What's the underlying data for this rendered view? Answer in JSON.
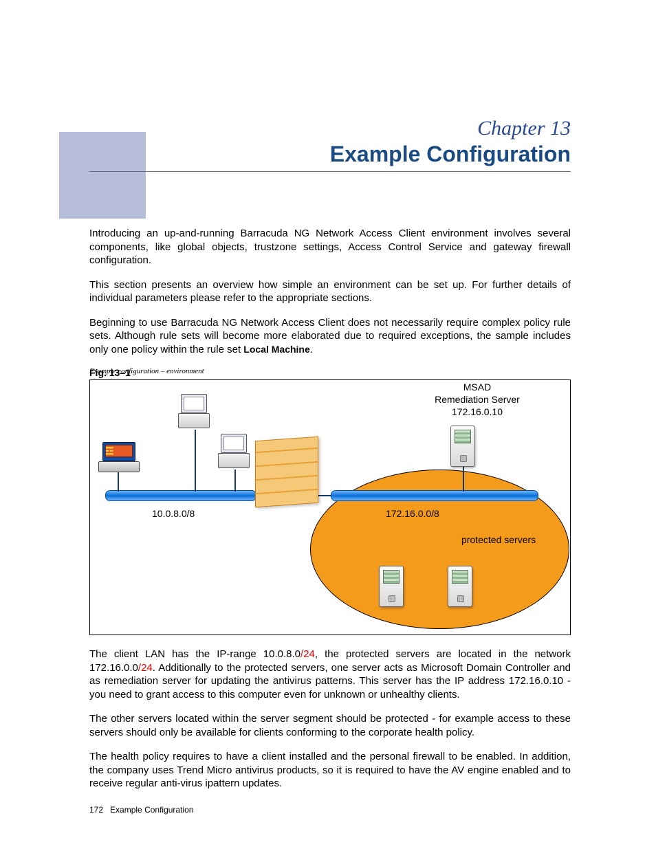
{
  "header": {
    "chapter_line": "Chapter 13",
    "title": "Example Configuration"
  },
  "paragraphs": {
    "p1": "Introducing an up-and-running Barracuda NG Network Access Client environment involves several components, like global objects, trustzone settings, Access Control Service and gateway firewall configuration.",
    "p2": "This section presents an overview how simple an environment can be set up. For further details of individual parameters please refer to the appropriate sections.",
    "p3a": "Beginning to use Barracuda NG Network Access Client does not necessarily require complex policy rule sets. Although rule sets will become more elaborated due to required exceptions, the sample includes only one policy within the rule set ",
    "p3b_bold": "Local Machine",
    "p3c": ".",
    "p4a": "The client LAN has the IP-range 10.0.8.0",
    "p4b_red": "/24",
    "p4c": ", the protected servers are located in the network 172.16.0.0",
    "p4d_red": "/24",
    "p4e": ". Additionally to the protected servers, one server acts as Microsoft Domain Controller and as remediation server for updating the antivirus patterns. This server has the IP address 172.16.0.10 - you need to grant access to this computer even for unknown or unhealthy clients.",
    "p5": "The other servers located within the server segment should be protected - for example access to these servers should only be available for clients conforming to the corporate health policy.",
    "p6": "The health policy requires to have a client installed and the personal firewall to be enabled. In addition, the company uses Trend Micro antivirus products, so it is required to have the AV engine enabled and to receive regular anti-virus ipattern updates."
  },
  "figure": {
    "caption_label": "Fig. 13–1",
    "caption_text": " Example configuration – environment",
    "left_net": "10.0.8.0/8",
    "right_net": "172.16.0.0/8",
    "msad_l1": "MSAD",
    "msad_l2": "Remediation Server",
    "msad_l3": "172.16.0.10",
    "protected": "protected servers"
  },
  "footer": {
    "page_no": "172",
    "section": "Example Configuration"
  }
}
